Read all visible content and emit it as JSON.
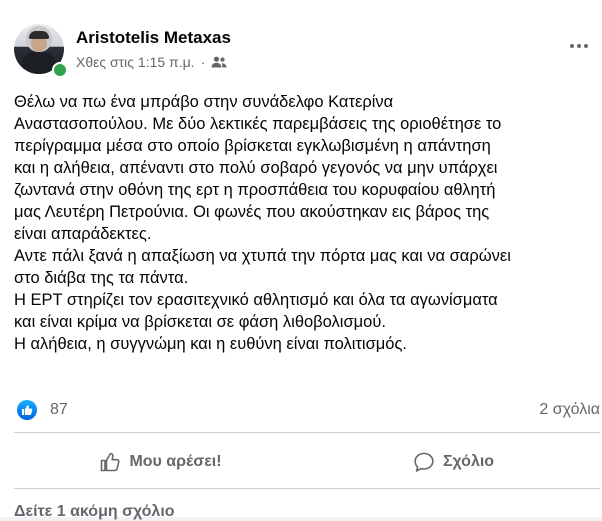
{
  "post": {
    "author": "Aristotelis Metaxas",
    "timestamp": "Χθες στις 1:15 π.μ.",
    "separator": "·",
    "audience_icon": "friends-icon",
    "text": "Θέλω να πω ένα μπράβο στην συνάδελφο Κατερίνα\nΑναστασοπούλου. Με δύο λεκτικές παρεμβάσεις της οριοθέτησε το\nπερίγραμμα μέσα στο οποίο βρίσκεται εγκλωβισμένη η απάντηση\nκαι η αλήθεια, απέναντι στο πολύ σοβαρό γεγονός να μην υπάρχει\nζωντανά στην οθόνη της ερτ η προσπάθεια του κορυφαίου αθλητή\nμας Λευτέρη Πετρούνια. Οι φωνές που ακούστηκαν εις βάρος της\nείναι απαράδεκτες.\nΑντε πάλι ξανά η απαξίωση να χτυπά την πόρτα μας και να σαρώνει\nστο διάβα της τα πάντα.\nΗ ΕΡΤ στηρίζει τον ερασιτεχνικό αθλητισμό και όλα τα αγωνίσματα\nκαι είναι κρίμα να βρίσκεται σε φάση λιθοβολισμού.\nΗ αλήθεια, η συγγνώμη και η ευθύνη είναι πολιτισμός."
  },
  "reactions": {
    "icon": "like-icon",
    "count": "87",
    "comments": "2 σχόλια"
  },
  "actions": {
    "like_label": "Μου αρέσει!",
    "comment_label": "Σχόλιο"
  },
  "more_comments": "Δείτε 1 ακόμη σχόλιο",
  "colors": {
    "accent": "#1877f2",
    "secondary_text": "#65676b",
    "online": "#31a24c"
  }
}
